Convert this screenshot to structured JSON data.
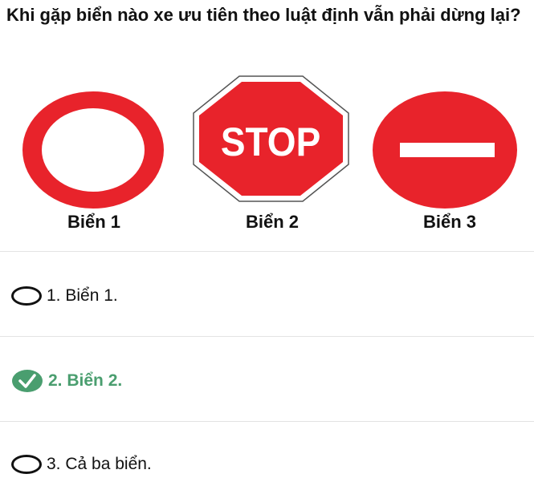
{
  "question": "Khi gặp biển nào xe ưu tiên theo luật định vẫn phải dừng lại?",
  "signs": [
    {
      "label": "Biển 1",
      "icon": "no-entry-both-directions-sign"
    },
    {
      "label": "Biển 2",
      "icon": "stop-sign",
      "text": "STOP"
    },
    {
      "label": "Biển 3",
      "icon": "no-entry-sign"
    }
  ],
  "options": [
    {
      "label": "1. Biển 1.",
      "selected": false,
      "correct": false
    },
    {
      "label": "2. Biển 2.",
      "selected": true,
      "correct": true
    },
    {
      "label": "3. Cả ba biển.",
      "selected": false,
      "correct": false
    }
  ],
  "colors": {
    "sign_red": "#e8232b",
    "correct_green": "#4a9e6f",
    "divider": "#e3e3e3"
  }
}
